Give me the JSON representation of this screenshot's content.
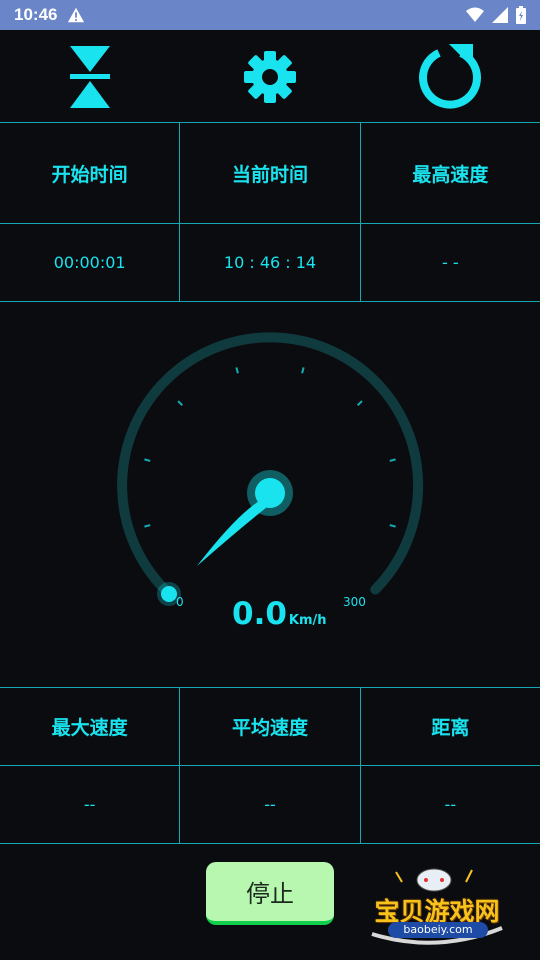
{
  "status_bar": {
    "time": "10:46"
  },
  "toolbar": {
    "collapse_icon": "hourglass-collapse-icon",
    "settings_icon": "gear-icon",
    "reset_icon": "refresh-icon"
  },
  "top_table": {
    "headers": [
      "开始时间",
      "当前时间",
      "最高速度"
    ],
    "values": [
      "00:00:01",
      "10 : 46 : 14",
      "- -"
    ]
  },
  "gauge": {
    "speed": "0.0",
    "unit": "Km/h",
    "min_label": "0",
    "max_label": "300",
    "min": 0,
    "max": 300,
    "current": 0,
    "tick_count": 8
  },
  "bottom_table": {
    "headers": [
      "最大速度",
      "平均速度",
      "距离"
    ],
    "values": [
      "--",
      "--",
      "--"
    ]
  },
  "stop_button": {
    "label": "停止"
  },
  "watermark": {
    "title": "宝贝游戏网",
    "domain": "baobeiy.com"
  },
  "colors": {
    "accent": "#19e3ee",
    "background": "#0b0c10",
    "status_bar": "#6a86c8",
    "stop_button": "#b7f7b0"
  }
}
